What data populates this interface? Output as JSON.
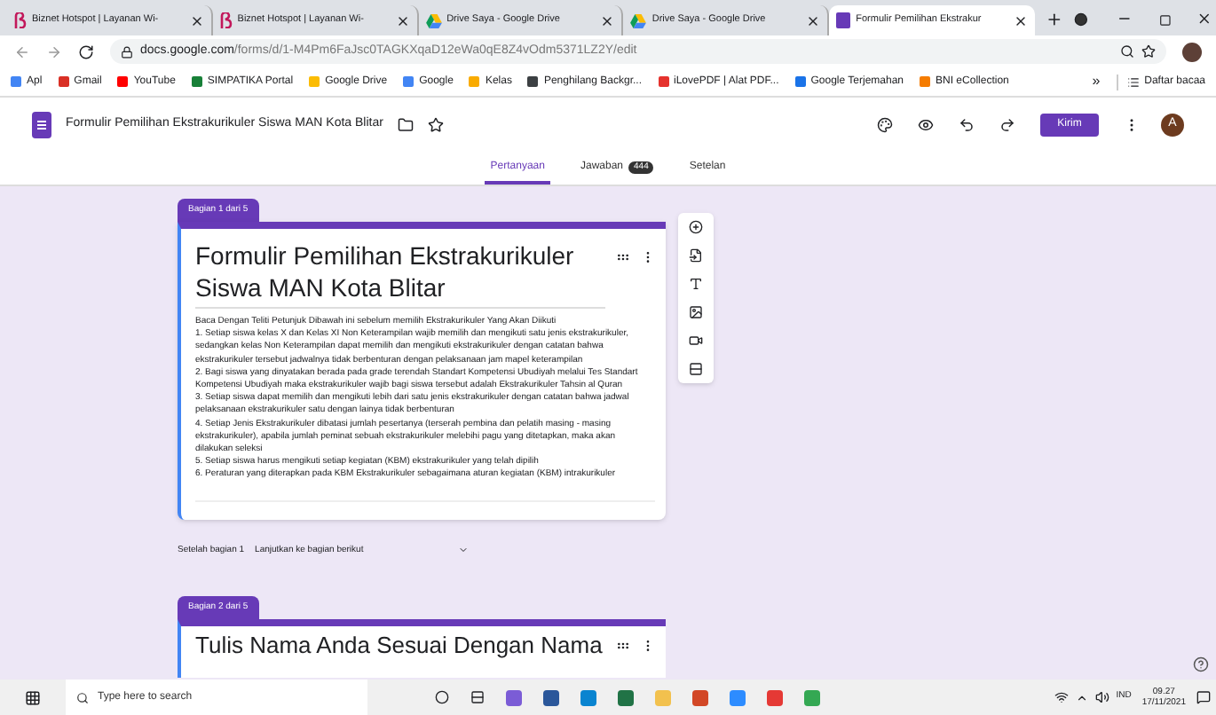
{
  "browser_tabs": [
    {
      "title": "Biznet Hotspot | Layanan Wi-",
      "kind": "biznet",
      "selected": false
    },
    {
      "title": "Biznet Hotspot | Layanan Wi-",
      "kind": "biznet",
      "selected": false
    },
    {
      "title": "Drive Saya - Google Drive",
      "kind": "drive",
      "selected": false
    },
    {
      "title": "Drive Saya - Google Drive",
      "kind": "drive",
      "selected": false
    },
    {
      "title": "Formulir Pemilihan Ekstrakur",
      "kind": "forms",
      "selected": true
    }
  ],
  "address": {
    "host": "docs.google.com",
    "path": "/forms/d/1-M4Pm6FaJsc0TAGKXqaD12eWa0qE8Z4vOdm5371LZ2Y/edit"
  },
  "bookmarks": [
    {
      "label": "Apl",
      "color": "#4285f4"
    },
    {
      "label": "Gmail",
      "color": "#d93025"
    },
    {
      "label": "YouTube",
      "color": "#ff0000"
    },
    {
      "label": "SIMPATIKA Portal",
      "color": "#188038"
    },
    {
      "label": "Google Drive",
      "color": "#fbbc04"
    },
    {
      "label": "Google",
      "color": "#4285f4"
    },
    {
      "label": "Kelas",
      "color": "#f9ab00"
    },
    {
      "label": "Penghilang Backgr...",
      "color": "#3c4043"
    },
    {
      "label": "iLovePDF | Alat PDF...",
      "color": "#e5322d"
    },
    {
      "label": "Google Terjemahan",
      "color": "#1a73e8"
    },
    {
      "label": "BNI eCollection",
      "color": "#f57c00"
    }
  ],
  "bookmarks_more": "»",
  "reading_list": "Daftar bacaa",
  "form_header": {
    "title": "Formulir Pemilihan Ekstrakurikuler Siswa MAN Kota Blitar",
    "send": "Kirim",
    "avatar": "A"
  },
  "form_tabs": [
    {
      "label": "Pertanyaan",
      "selected": true
    },
    {
      "label": "Jawaban",
      "badge": "444",
      "selected": false
    },
    {
      "label": "Setelan",
      "selected": false
    }
  ],
  "sections": [
    {
      "badge": "Bagian 1 dari 5",
      "title": "Formulir Pemilihan Ekstrakurikuler Siswa MAN Kota Blitar",
      "description": [
        "Baca Dengan Teliti Petunjuk Dibawah ini sebelum memilih Ekstrakurikuler Yang Akan Diikuti",
        "1. Setiap siswa kelas X dan Kelas XI Non Keterampilan wajib memilih dan mengikuti satu jenis ekstrakurikuler, sedangkan kelas Non Keterampilan dapat memilih dan mengikuti ekstrakurikuler dengan catatan bahwa ekstrakurikuler tersebut jadwalnya tidak berbenturan dengan pelaksanaan jam mapel keterampilan",
        "2. Bagi siswa yang dinyatakan berada pada grade terendah Standart Kompetensi Ubudiyah melalui Tes Standart Kompetensi Ubudiyah maka ekstrakurikuler wajib bagi siswa tersebut adalah Ekstrakurikuler Tahsin al Quran",
        "3. Setiap siswa dapat memilih dan mengikuti lebih dari satu jenis ekstrakurikuler  dengan catatan bahwa jadwal pelaksanaan ekstrakurikuler satu dengan lainya tidak berbenturan",
        "4. Setiap Jenis Ekstrakurikuler dibatasi jumlah pesertanya (terserah pembina dan pelatih masing - masing ekstrakurikuler), apabila jumlah peminat sebuah ekstrakurikuler melebihi pagu yang ditetapkan, maka akan dilakukan seleksi",
        "5. Setiap siswa harus mengikuti setiap kegiatan (KBM) ekstrakurikuler yang telah dipilih",
        "6. Peraturan yang diterapkan pada KBM Ekstrakurikuler sebagaimana aturan kegiatan (KBM) intrakurikuler"
      ],
      "after_label": "Setelah bagian 1",
      "after_value": "Lanjutkan ke bagian berikut"
    },
    {
      "badge": "Bagian 2 dari 5",
      "title": "Tulis Nama Anda Sesuai Dengan Nama"
    }
  ],
  "taskbar": {
    "search_placeholder": "Type here to search",
    "language": "IND",
    "time": "09.27",
    "date": "17/11/2021",
    "apps": [
      {
        "color": "#7b5cd6"
      },
      {
        "color": "#2b579a"
      },
      {
        "color": "#0a84d0"
      },
      {
        "color": "#217346"
      },
      {
        "color": "#f2c14e"
      },
      {
        "color": "#d24726"
      },
      {
        "color": "#2d8cff"
      },
      {
        "color": "#e53935"
      },
      {
        "color": "#34a853"
      }
    ]
  }
}
